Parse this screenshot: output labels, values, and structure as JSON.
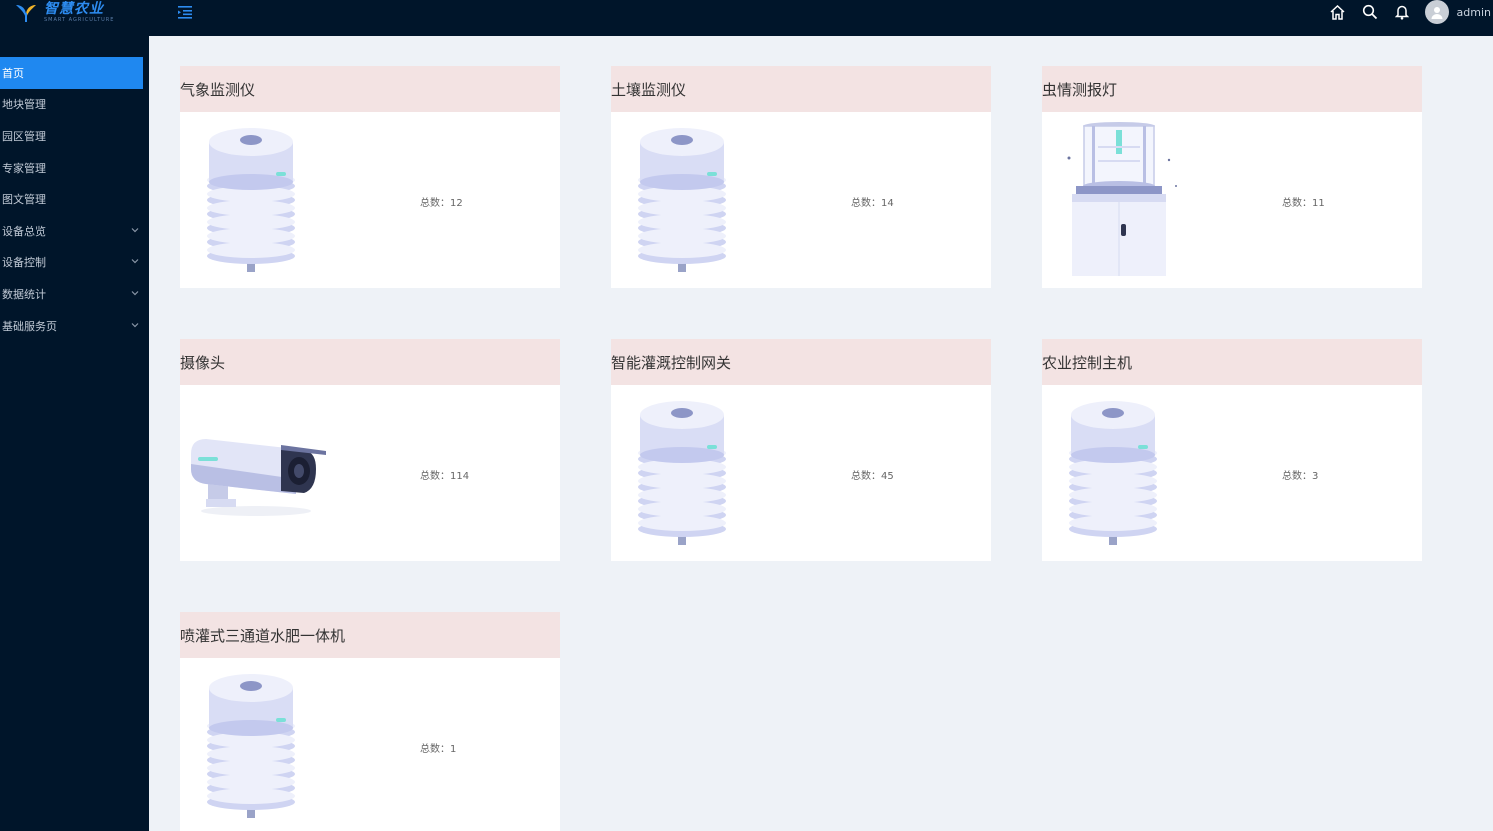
{
  "app": {
    "logo_title": "智慧农业",
    "logo_subtitle": "SMART AGRICULTURE",
    "username": "admin"
  },
  "icons": {
    "menu_toggle": "menu-fold-icon",
    "home": "home-icon",
    "search": "search-icon",
    "bell": "bell-icon",
    "avatar": "user-avatar-icon"
  },
  "colors": {
    "nav_bg": "#00152a",
    "nav_active": "#1f88f0",
    "card_header": "#f3e3e3",
    "content_bg": "#eef2f7"
  },
  "sidebar": {
    "items": [
      {
        "label": "首页",
        "active": true,
        "expandable": false
      },
      {
        "label": "地块管理",
        "active": false,
        "expandable": false
      },
      {
        "label": "园区管理",
        "active": false,
        "expandable": false
      },
      {
        "label": "专家管理",
        "active": false,
        "expandable": false
      },
      {
        "label": "图文管理",
        "active": false,
        "expandable": false
      },
      {
        "label": "设备总览",
        "active": false,
        "expandable": true
      },
      {
        "label": "设备控制",
        "active": false,
        "expandable": true
      },
      {
        "label": "数据统计",
        "active": false,
        "expandable": true
      },
      {
        "label": "基础服务页",
        "active": false,
        "expandable": true
      }
    ]
  },
  "devices": [
    {
      "title": "气象监测仪",
      "count_label": "总数：",
      "count": "12",
      "image": "sensor"
    },
    {
      "title": "土壤监测仪",
      "count_label": "总数：",
      "count": "14",
      "image": "sensor"
    },
    {
      "title": "虫情测报灯",
      "count_label": "总数：",
      "count": "11",
      "image": "insect-lamp"
    },
    {
      "title": "摄像头",
      "count_label": "总数：",
      "count": "114",
      "image": "camera"
    },
    {
      "title": "智能灌溉控制网关",
      "count_label": "总数：",
      "count": "45",
      "image": "sensor"
    },
    {
      "title": "农业控制主机",
      "count_label": "总数：",
      "count": "3",
      "image": "sensor"
    },
    {
      "title": "喷灌式三通道水肥一体机",
      "count_label": "总数：",
      "count": "1",
      "image": "sensor"
    }
  ]
}
